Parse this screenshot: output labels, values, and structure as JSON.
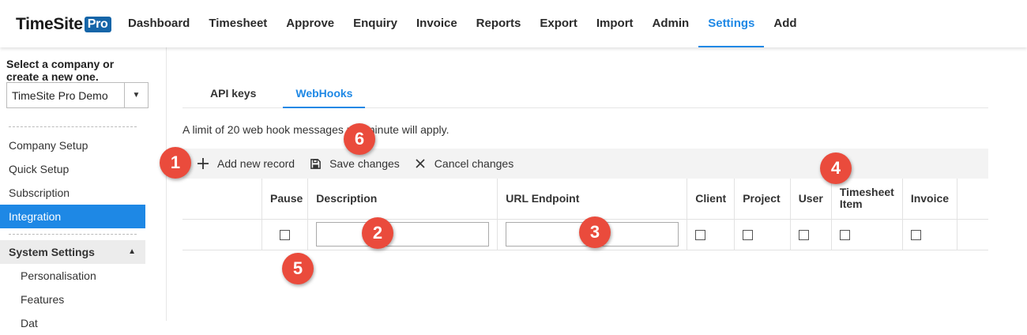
{
  "logo": {
    "text": "TimeSite",
    "badge": "Pro"
  },
  "nav": {
    "items": [
      {
        "label": "Dashboard"
      },
      {
        "label": "Timesheet"
      },
      {
        "label": "Approve"
      },
      {
        "label": "Enquiry"
      },
      {
        "label": "Invoice"
      },
      {
        "label": "Reports"
      },
      {
        "label": "Export"
      },
      {
        "label": "Import"
      },
      {
        "label": "Admin"
      },
      {
        "label": "Settings"
      },
      {
        "label": "Add"
      }
    ],
    "active": "Settings"
  },
  "sidebar": {
    "select_label": "Select a company or create a new one.",
    "company_value": "TimeSite Pro Demo",
    "items": [
      {
        "label": "Company Setup"
      },
      {
        "label": "Quick Setup"
      },
      {
        "label": "Subscription"
      },
      {
        "label": "Integration"
      }
    ],
    "section": {
      "label": "System Settings"
    },
    "sub_items": [
      {
        "label": "Personalisation"
      },
      {
        "label": "Features"
      },
      {
        "label": "Dat"
      }
    ]
  },
  "tabs": [
    {
      "label": "API keys"
    },
    {
      "label": "WebHooks"
    }
  ],
  "limit_note": "A limit of 20 web hook messages per minute will apply.",
  "toolbar": {
    "add_label": "Add new record",
    "save_label": "Save changes",
    "cancel_label": "Cancel changes"
  },
  "grid": {
    "columns": {
      "pause": "Pause",
      "description": "Description",
      "url": "URL Endpoint",
      "client": "Client",
      "project": "Project",
      "user": "User",
      "timesheet_item": "Timesheet Item",
      "invoice": "Invoice"
    }
  },
  "badges": [
    "1",
    "2",
    "3",
    "4",
    "5",
    "6"
  ],
  "colors": {
    "accent": "#1e88e5",
    "badge": "#ea4b3c",
    "logo_badge": "#1565a8"
  }
}
